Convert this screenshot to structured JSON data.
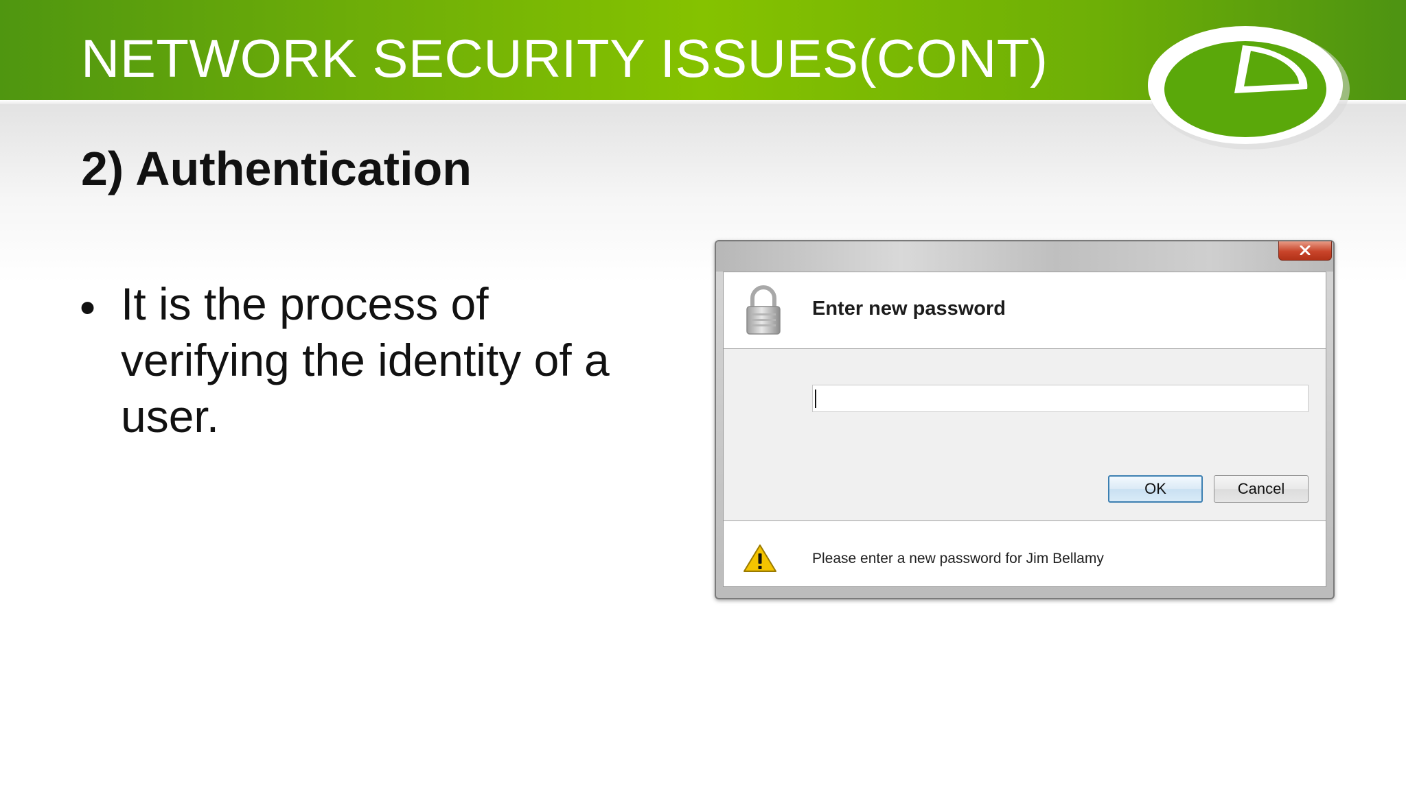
{
  "slide": {
    "title": "NETWORK SECURITY ISSUES(CONT)",
    "subheading": "2) Authentication",
    "bullets": [
      {
        "marker": "•",
        "text": "It is the process of verifying the identity of a user."
      }
    ]
  },
  "dialog": {
    "close_label": "x",
    "title": "Enter new password",
    "password_value": "",
    "buttons": {
      "ok": "OK",
      "cancel": "Cancel"
    },
    "footer_message": "Please enter a new password for Jim Bellamy",
    "icons": {
      "header": "lock-icon",
      "footer": "warning-icon",
      "close": "close-icon"
    }
  },
  "colors": {
    "header_green": "#6dad08",
    "logo_green": "#5aa80a",
    "close_red": "#c8442a",
    "ok_border_blue": "#3c7fb1",
    "warning_yellow": "#f4c400"
  }
}
